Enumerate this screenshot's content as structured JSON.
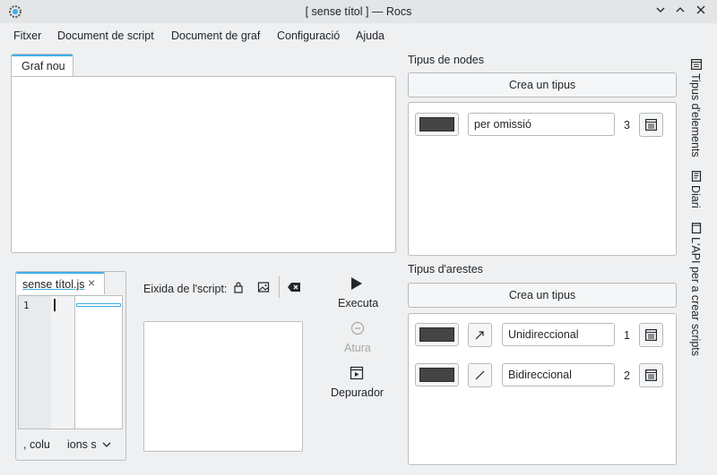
{
  "window": {
    "title": "[ sense títol ] — Rocs"
  },
  "menu": [
    "Fitxer",
    "Document de script",
    "Document de graf",
    "Configuració",
    "Ajuda"
  ],
  "graph_tab": {
    "label": "Graf nou"
  },
  "script_tab": {
    "label": "sense títol.js"
  },
  "editor": {
    "line_number": "1",
    "status_left": ", colu",
    "status_right": "ions s"
  },
  "output": {
    "label": "Eixida de l'script:"
  },
  "actions": {
    "execute": "Executa",
    "stop": "Atura",
    "debugger": "Depurador"
  },
  "node_types": {
    "header": "Tipus de nodes",
    "create_label": "Crea un tipus",
    "items": [
      {
        "name": "per omissió",
        "id": "3",
        "color": "#444444"
      }
    ]
  },
  "edge_types": {
    "header": "Tipus d'arestes",
    "create_label": "Crea un tipus",
    "items": [
      {
        "name": "Unidireccional",
        "id": "1",
        "color": "#444444",
        "direction_icon": "arrow-icon"
      },
      {
        "name": "Bidireccional",
        "id": "2",
        "color": "#444444",
        "direction_icon": "line-icon"
      }
    ]
  },
  "side_tabs": [
    "Tipus d'elements",
    "Diari",
    "L'API per a crear scripts"
  ],
  "colors": {
    "accent": "#3daee9",
    "window_bg": "#eff0f1",
    "swatch": "#444444"
  }
}
